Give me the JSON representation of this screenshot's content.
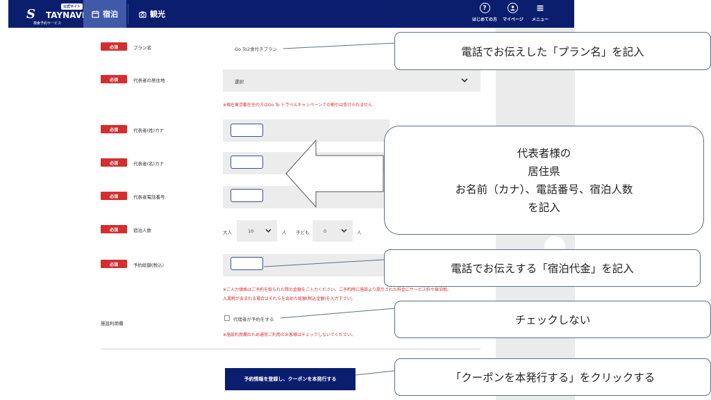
{
  "header": {
    "logo_badge": "公式サイト",
    "logo_mark": "S",
    "logo_word": "TAYNAVI",
    "logo_sub": "検索予約サービス",
    "tabs": [
      {
        "label": "宿泊",
        "icon": "calendar-icon"
      },
      {
        "label": "観光",
        "icon": "camera-icon"
      }
    ],
    "buttons": [
      {
        "label": "はじめての方",
        "icon": "question-icon",
        "glyph": "?"
      },
      {
        "label": "マイページ",
        "icon": "user-icon",
        "glyph": "●"
      },
      {
        "label": "メニュー",
        "icon": "menu-icon",
        "glyph": "≡"
      }
    ],
    "bg_color": "#0b1e6e",
    "active_tab_color": "#3f5aa8"
  },
  "form": {
    "required_label": "必須",
    "plan_name": {
      "label": "プラン名",
      "value": "Go To2食付きプラン"
    },
    "residence": {
      "label": "代表者の居住地",
      "value": "選択"
    },
    "residence_note": "※現在東京都在住の方はGo To トラベルキャンペーンでの割引は受けられません",
    "last_name_kana": {
      "label": "代表者(姓)カナ"
    },
    "first_name_kana": {
      "label": "代表者(名)カナ"
    },
    "phone": {
      "label": "代表者電話番号"
    },
    "guests": {
      "label": "宿泊人数",
      "adult_label": "大人",
      "adult_value": "10",
      "unit": "人",
      "child_label": "子ども",
      "child_value": "0"
    },
    "total": {
      "label": "予約総額(税込)"
    },
    "total_note_1": "※ご入力価格はご予約を取られた際の金額をご入力ください。ご予約時に施設より提示された料金にサービス料や宿泊税、",
    "total_note_2": "入湯税が含まれる場合はそれらを含めた総額(税込金額)を入力下さい。",
    "facility": {
      "label": "施設利用欄",
      "checkbox_label": "代理者が予約をする"
    },
    "facility_note": "※施設利用欄のため通常ご利用のお客様はチェックしないでください。",
    "submit_label": "予約情報を登録し、クーポンを本発行する"
  },
  "callouts": {
    "plan": "電話でお伝えした「プラン名」を記入",
    "representative": [
      "代表者様の",
      "居住県",
      "お名前（カナ）、電話番号、宿泊人数",
      "を記入"
    ],
    "amount": "電話でお伝えする「宿泊代金」を記入",
    "check": "チェックしない",
    "coupon": "「クーポンを本発行する」をクリックする"
  },
  "colors": {
    "required_badge": "#d32f2f",
    "note_text": "#d32f2f",
    "input_border": "#3a4f95"
  }
}
